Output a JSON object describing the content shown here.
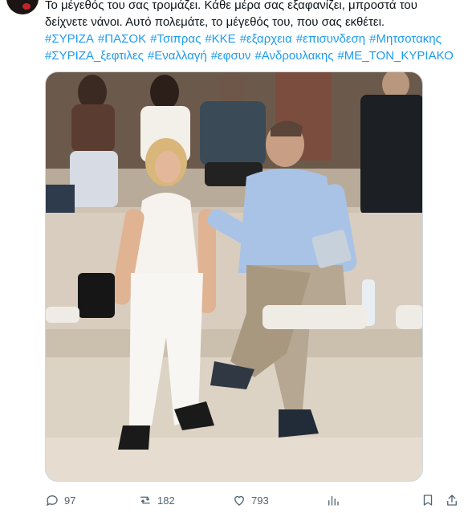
{
  "tweet": {
    "text_lines": [
      "Το μέγεθός του σας τρομάζει. Κάθε μέρα σας εξαφανίζει, μπροστά του",
      "δείχνετε νάνοι. Αυτό πολεμάτε, το μέγεθός του, που σας εκθέτει."
    ],
    "hashtags_line1": [
      "#ΣΥΡΙΖΑ",
      "#ΠΑΣΟΚ",
      "#Τσιπρας",
      "#ΚΚΕ",
      "#εξαρχεια",
      "#επισυνδεση",
      "#Μητσοτακης"
    ],
    "hashtags_line2": [
      "#ΣΥΡΙΖΑ_ξεφτιλες",
      "#Εναλλαγή",
      "#εφσυν",
      "#Ανδρουλακης",
      "#ΜΕ_ΤΟΝ_ΚΥΡΙΑΚΟ"
    ]
  },
  "actions": {
    "replies": "97",
    "retweets": "182",
    "likes": "793"
  },
  "colors": {
    "link": "#1d9bf0",
    "muted": "#536471",
    "text": "#0f1419"
  },
  "icons": [
    "reply-icon",
    "retweet-icon",
    "like-icon",
    "views-icon",
    "bookmark-icon",
    "share-icon"
  ]
}
